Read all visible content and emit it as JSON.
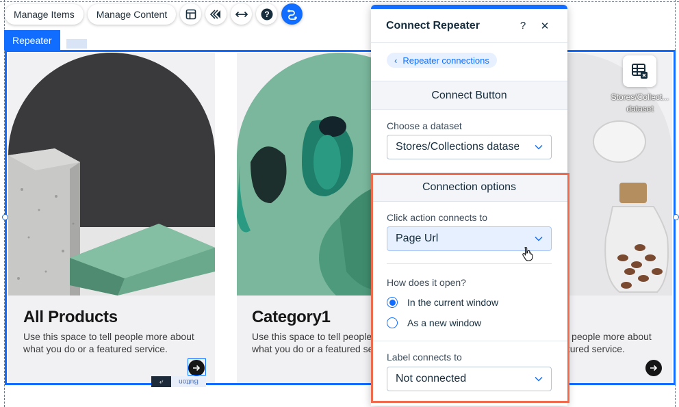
{
  "toolbar": {
    "manage_items": "Manage Items",
    "manage_content": "Manage Content",
    "icons": [
      "layout-icon",
      "animation-icon",
      "stretch-icon",
      "help-icon",
      "connect-icon"
    ]
  },
  "repeater": {
    "tag_label": "Repeater",
    "items": [
      {
        "title": "All Products",
        "description": "Use this space to tell people more about what you do or a featured service."
      },
      {
        "title": "Category1",
        "description": "Use this space to tell people more about what you do or a featured service."
      },
      {
        "title": "",
        "description": "Use this space to tell people more about what you do or a featured service."
      }
    ],
    "button_tag": "Button"
  },
  "dataset_chip": {
    "label": "Stores/Collect... dataset"
  },
  "panel": {
    "title": "Connect Repeater",
    "breadcrumb": "Repeater connections",
    "section_title": "Connect Button",
    "dataset_label": "Choose a dataset",
    "dataset_value": "Stores/Collections dataset",
    "options_title": "Connection options",
    "click_action_label": "Click action connects to",
    "click_action_value": "Page Url",
    "open_question": "How does it open?",
    "open_options": [
      {
        "label": "In the current window",
        "selected": true
      },
      {
        "label": "As a new window",
        "selected": false
      }
    ],
    "label_connects_label": "Label connects to",
    "label_connects_value": "Not connected"
  },
  "colors": {
    "accent": "#116dff",
    "highlight": "#ee6c4d"
  }
}
